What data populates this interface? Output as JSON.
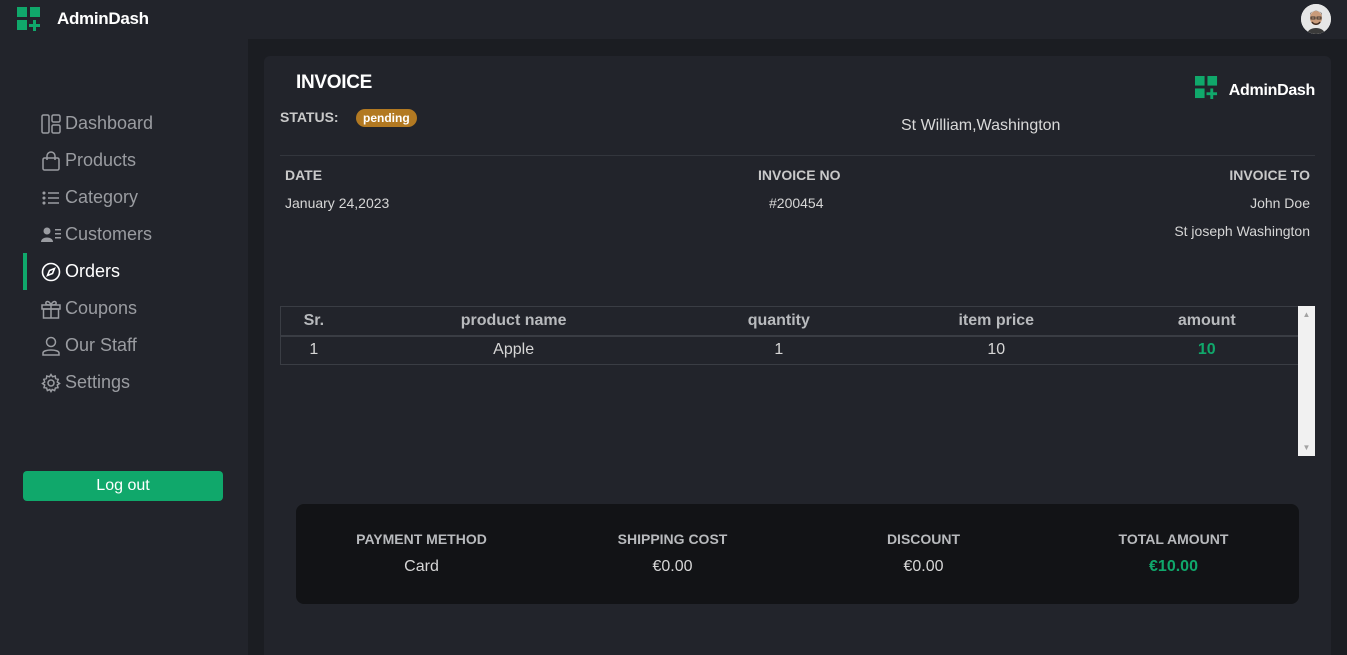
{
  "app": {
    "name": "AdminDash",
    "accent_color": "#10a86b"
  },
  "sidebar": {
    "items": [
      {
        "label": "Dashboard",
        "icon": "dashboard-icon"
      },
      {
        "label": "Products",
        "icon": "shopping-bag-icon"
      },
      {
        "label": "Category",
        "icon": "list-icon"
      },
      {
        "label": "Customers",
        "icon": "customers-icon"
      },
      {
        "label": "Orders",
        "icon": "compass-icon",
        "active": true
      },
      {
        "label": "Coupons",
        "icon": "gift-icon"
      },
      {
        "label": "Our Staff",
        "icon": "user-icon"
      },
      {
        "label": "Settings",
        "icon": "gear-icon"
      }
    ],
    "logout_label": "Log out"
  },
  "invoice": {
    "title": "INVOICE",
    "status_label": "STATUS:",
    "status_value": "pending",
    "status_color": "#b27922",
    "company_address": "St William,Washington",
    "date_header": "DATE",
    "date_value": "January 24,2023",
    "invoice_no_header": "INVOICE NO",
    "invoice_no_value": "#200454",
    "invoice_to_header": "INVOICE TO",
    "invoice_to_name": "John Doe",
    "invoice_to_address": "St joseph Washington"
  },
  "items_table": {
    "columns": [
      "Sr.",
      "product name",
      "quantity",
      "item price",
      "amount"
    ],
    "rows": [
      [
        "1",
        "Apple",
        "1",
        "10",
        "10"
      ]
    ]
  },
  "summary": {
    "payment_method_header": "PAYMENT METHOD",
    "payment_method_value": "Card",
    "shipping_cost_header": "SHIPPING COST",
    "shipping_cost_value": "€0.00",
    "discount_header": "DISCOUNT",
    "discount_value": "€0.00",
    "total_amount_header": "TOTAL AMOUNT",
    "total_amount_value": "€10.00"
  }
}
